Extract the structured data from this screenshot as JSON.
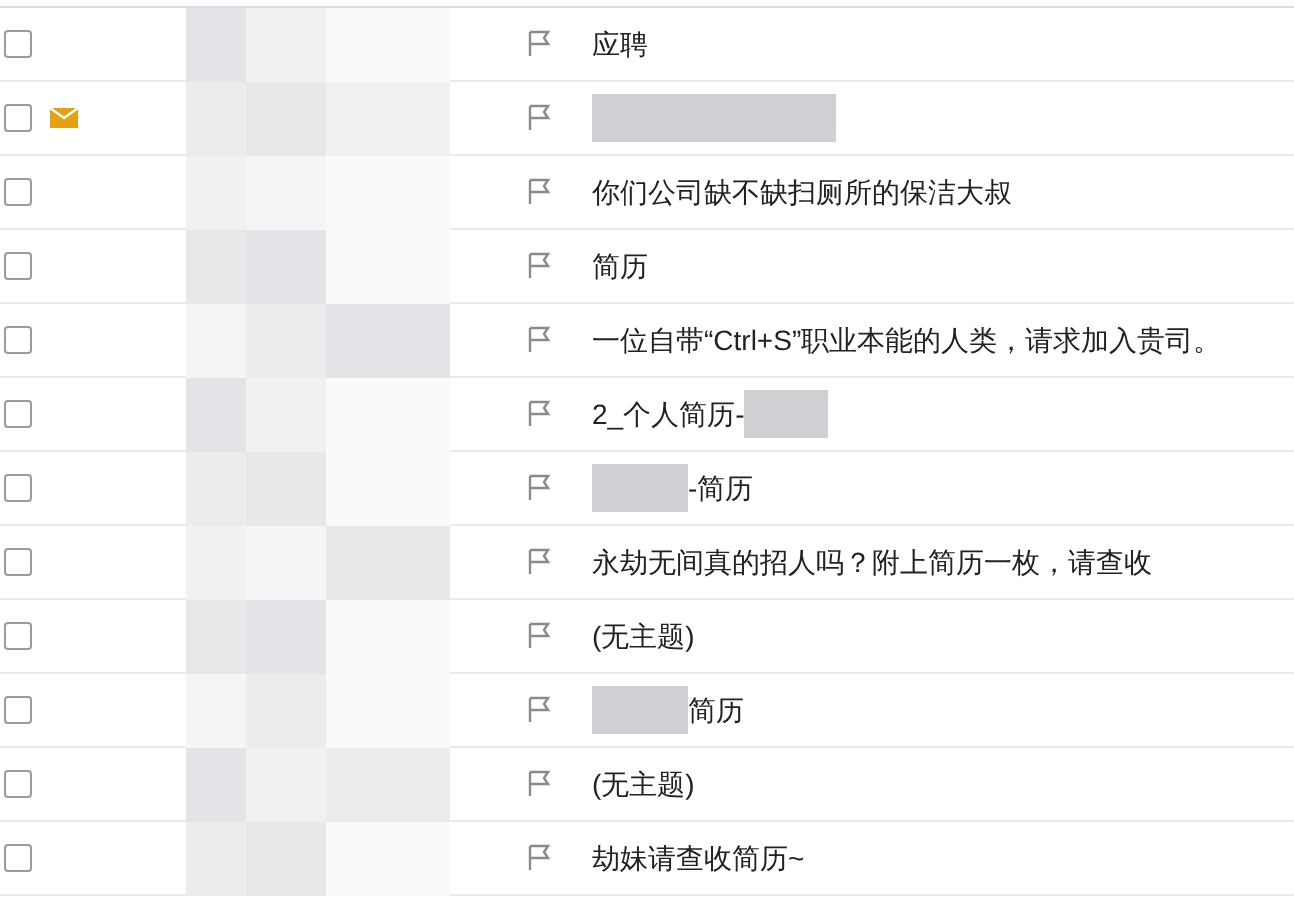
{
  "messages": [
    {
      "checked": false,
      "unread": false,
      "subject": "应聘",
      "kind": "plain"
    },
    {
      "checked": false,
      "unread": true,
      "kind": "hidden"
    },
    {
      "checked": false,
      "unread": false,
      "subject": "你们公司缺不缺扫厕所的保洁大叔",
      "kind": "plain"
    },
    {
      "checked": false,
      "unread": false,
      "subject": "简历",
      "kind": "plain"
    },
    {
      "checked": false,
      "unread": false,
      "subject": "一位自带“Ctrl+S”职业本能的人类，请求加入贵司。",
      "kind": "plain"
    },
    {
      "checked": false,
      "unread": false,
      "subject": "2_个人简历-",
      "kind": "tail"
    },
    {
      "checked": false,
      "unread": false,
      "subject": "-简历",
      "kind": "head"
    },
    {
      "checked": false,
      "unread": false,
      "subject": "永劫无间真的招人吗？附上简历一枚，请查收",
      "kind": "plain"
    },
    {
      "checked": false,
      "unread": false,
      "subject": "(无主题)",
      "kind": "plain"
    },
    {
      "checked": false,
      "unread": false,
      "subject": "简历",
      "kind": "head"
    },
    {
      "checked": false,
      "unread": false,
      "subject": "(无主题)",
      "kind": "plain"
    },
    {
      "checked": false,
      "unread": false,
      "subject": "劫妹请查收简历~",
      "kind": "plain"
    }
  ]
}
